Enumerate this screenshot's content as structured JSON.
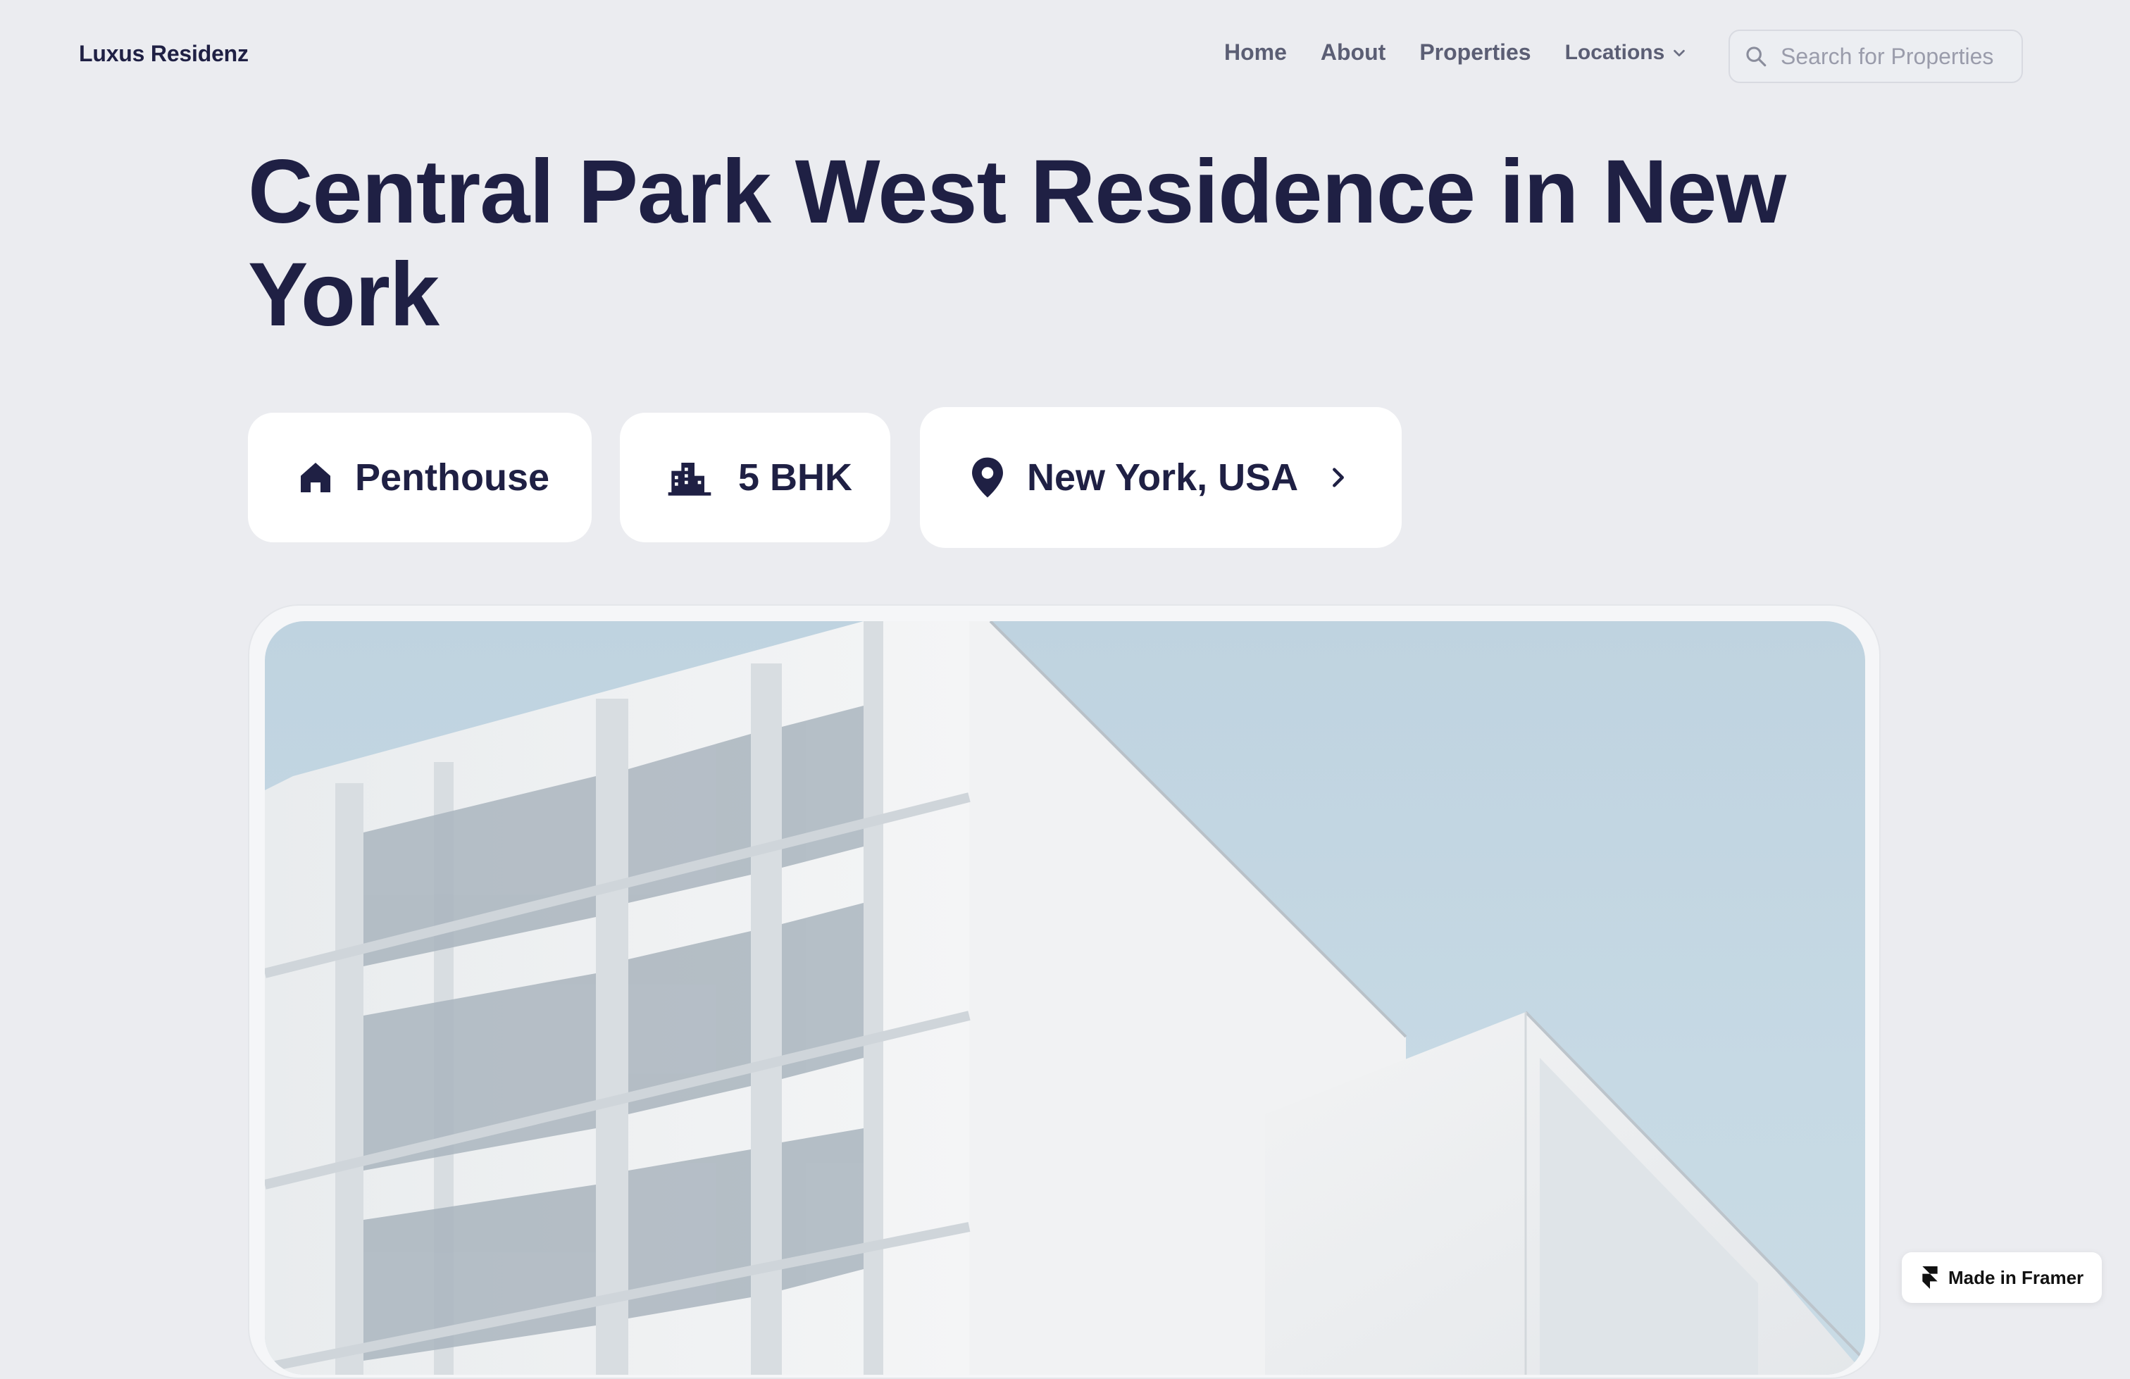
{
  "header": {
    "brand": "Luxus Residenz",
    "nav": {
      "home": "Home",
      "about": "About",
      "properties": "Properties",
      "locations": "Locations"
    },
    "search": {
      "placeholder": "Search for Properties",
      "value": ""
    }
  },
  "property": {
    "title": "Central Park West Residence in New York",
    "type": "Penthouse",
    "rooms": "5 BHK",
    "location": "New York, USA"
  },
  "badge": {
    "label": "Made in Framer"
  },
  "icons": {
    "search": "search-icon",
    "dropdown": "chevron-down-icon",
    "type": "home-icon",
    "rooms": "building-icon",
    "location": "map-pin-icon",
    "location_action": "chevron-right-icon",
    "framer": "framer-logo-icon"
  },
  "colors": {
    "background": "#ebecf0",
    "text_dark": "#1f2044",
    "nav_text": "#5b5e74",
    "chip_bg": "#ffffff",
    "sky": "#c4d8e3"
  }
}
